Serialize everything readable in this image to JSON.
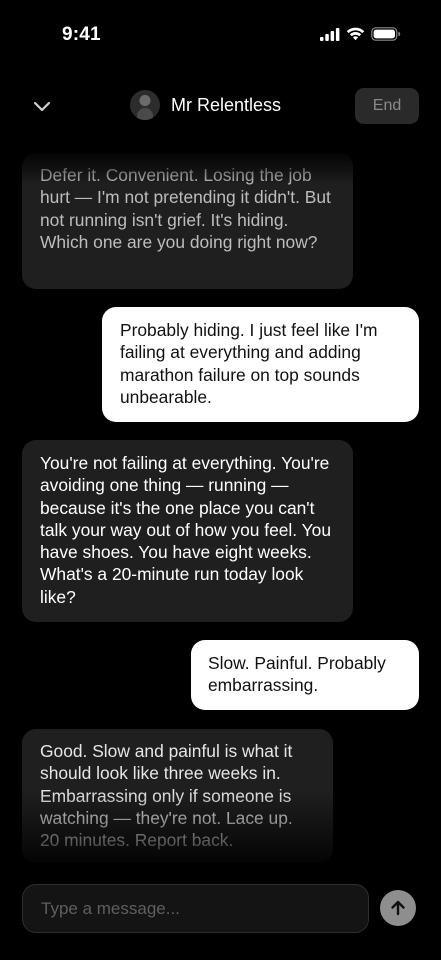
{
  "status_bar": {
    "time": "9:41",
    "icons": [
      "cellular-signal-icon",
      "wifi-icon",
      "battery-icon"
    ]
  },
  "header": {
    "back_icon": "chevron-down-icon",
    "contact_name": "Mr Relentless",
    "end_label": "End"
  },
  "messages": [
    {
      "sender": "them",
      "text": "Defer it. Convenient. Losing the job hurt — I'm not pretending it didn't. But not running isn't grief. It's hiding. Which one are you doing right now?"
    },
    {
      "sender": "me",
      "text": "Probably hiding. I just feel like I'm failing at everything and adding marathon failure on top sounds unbearable."
    },
    {
      "sender": "them",
      "text": "You're not failing at everything. You're avoiding one thing — running — because it's the one place you can't talk your way out of how you feel. You have shoes. You have eight weeks. What's a 20-minute run today look like?"
    },
    {
      "sender": "me",
      "text": "Slow. Painful. Probably embarrassing."
    },
    {
      "sender": "them",
      "text": "Good. Slow and painful is what it should look like three weeks in. Embarrassing only if someone is watching — they're not. Lace up. 20 minutes. Report back."
    }
  ],
  "composer": {
    "placeholder": "Type a message...",
    "value": "",
    "send_icon": "arrow-up-icon"
  },
  "colors": {
    "background": "#000000",
    "incoming_bubble": "#1f1f1f",
    "outgoing_bubble": "#ffffff",
    "send_button": "#8e8e8e"
  }
}
